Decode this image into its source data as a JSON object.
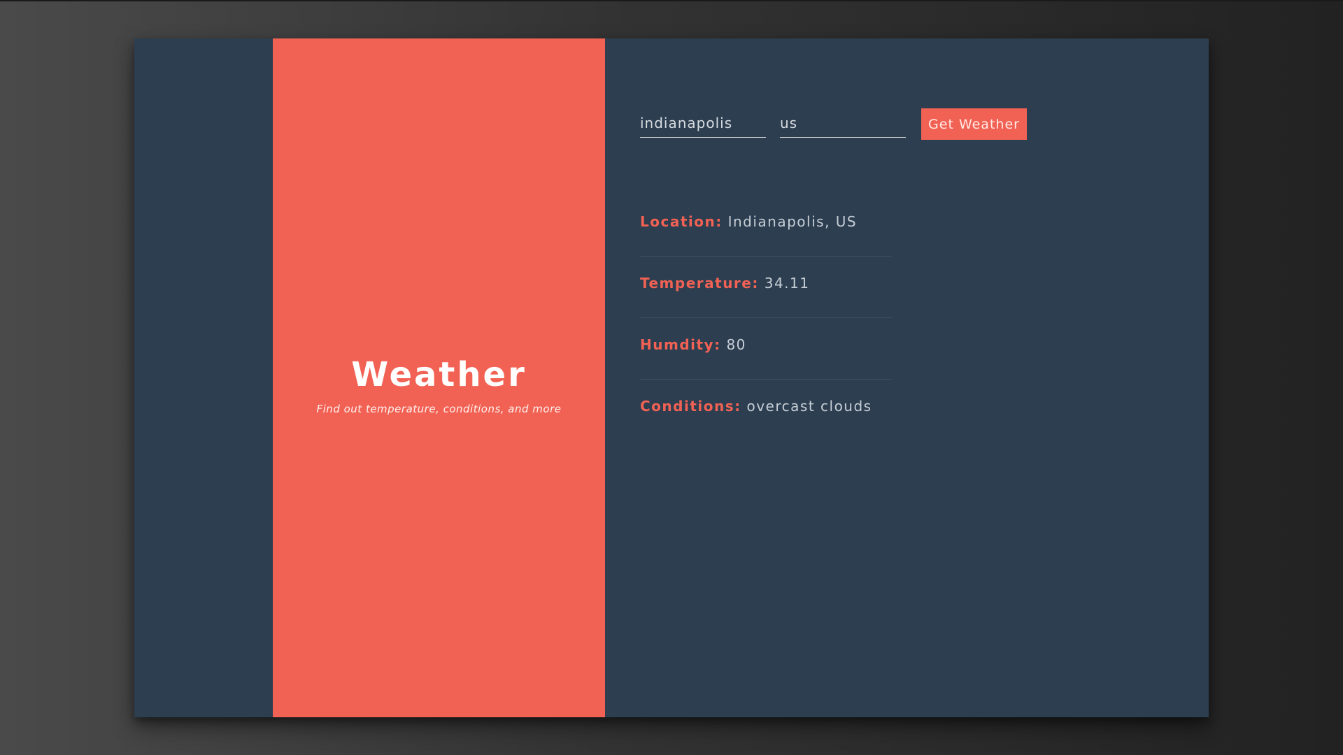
{
  "app": {
    "title": "Weather",
    "subtitle": "Find out temperature, conditions, and more"
  },
  "form": {
    "city_value": "indianapolis",
    "country_value": "us",
    "submit_label": "Get Weather"
  },
  "results": [
    {
      "label": "Location:",
      "value": "Indianapolis, US"
    },
    {
      "label": "Temperature:",
      "value": "34.11"
    },
    {
      "label": "Humdity:",
      "value": "80"
    },
    {
      "label": "Conditions:",
      "value": "overcast clouds"
    }
  ],
  "colors": {
    "accent": "#f26254",
    "panel_dark": "#2c3e50"
  }
}
